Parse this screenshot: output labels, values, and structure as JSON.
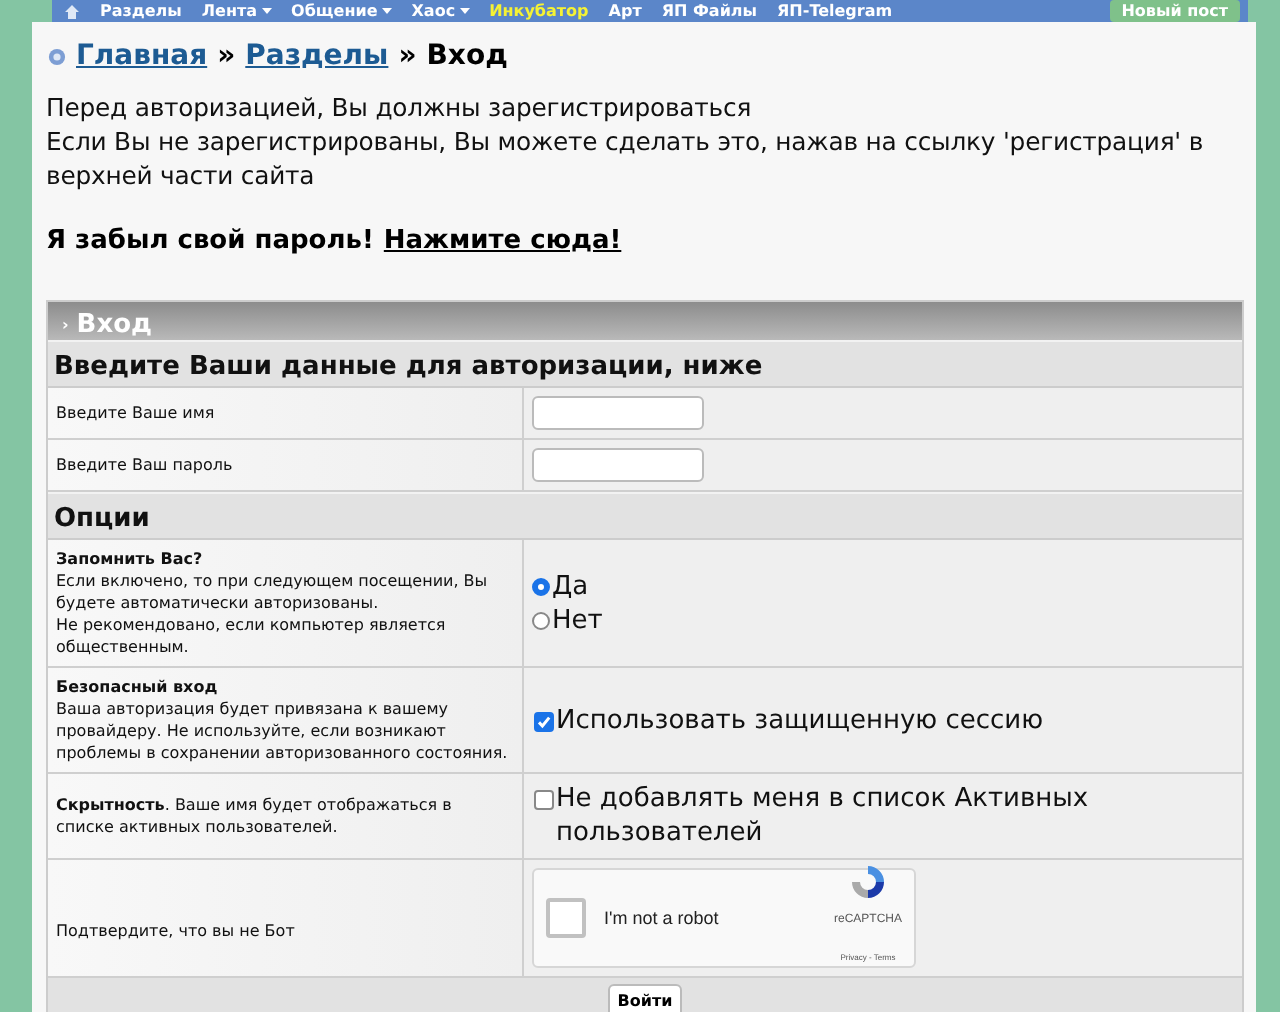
{
  "nav": {
    "items": [
      {
        "label": "Разделы",
        "dropdown": false,
        "highlight": false
      },
      {
        "label": "Лента",
        "dropdown": true,
        "highlight": false
      },
      {
        "label": "Общение",
        "dropdown": true,
        "highlight": false
      },
      {
        "label": "Хаос",
        "dropdown": true,
        "highlight": false
      },
      {
        "label": "Инкубатор",
        "dropdown": false,
        "highlight": true
      },
      {
        "label": "Арт",
        "dropdown": false,
        "highlight": false
      },
      {
        "label": "ЯП Файлы",
        "dropdown": false,
        "highlight": false
      },
      {
        "label": "ЯП-Telegram",
        "dropdown": false,
        "highlight": false
      }
    ],
    "new_post_button": "Новый пост"
  },
  "breadcrumbs": [
    {
      "label": "Главная",
      "link": true
    },
    {
      "label": "Разделы",
      "link": true
    },
    {
      "label": "Вход",
      "link": false
    }
  ],
  "separator": "»",
  "intro": [
    "Перед авторизацией, Вы должны зарегистрироваться",
    "Если Вы не зарегистрированы, Вы можете сделать это, нажав на ссылку 'регистрация' в верхней части сайта"
  ],
  "forgot": {
    "text": "Я забыл свой пароль!",
    "link": "Нажмите сюда!"
  },
  "form": {
    "title": "Вход",
    "marker": "›",
    "credentials": {
      "heading": "Введите Ваши данные для авторизации, ниже",
      "fields": [
        {
          "label": "Введите Ваше имя"
        },
        {
          "label": "Введите Ваш пароль"
        }
      ]
    },
    "options": {
      "heading": "Опции",
      "rows": [
        {
          "kind": "radio",
          "title": "Запомнить Вас?",
          "description": "Если включено, то при следующем посещении, Вы будете автоматически авторизованы.",
          "note": "Не рекомендовано, если компьютер является общественным.",
          "choices": [
            {
              "label": "Да",
              "selected": true
            },
            {
              "label": "Нет",
              "selected": false
            }
          ]
        },
        {
          "kind": "checkbox",
          "title": "Безопасный вход",
          "description": "Ваша авторизация будет привязана к вашему провайдеру. Не используйте, если возникают проблемы в сохранении авторизованного состояния.",
          "label": "Использовать защищенную сессию",
          "checked": true
        },
        {
          "kind": "checkbox",
          "description": "**Скрытность**. Ваше имя будет отображаться в списке активных пользователей.",
          "label": "Не добавлять меня в список Активных пользователей",
          "checked": false
        },
        {
          "kind": "captcha",
          "description": "Подтвердите, что вы не Бот",
          "captcha": {
            "label": "I'm not a robot",
            "checked": false,
            "brand": "reCAPTCHA",
            "links": "Privacy - Terms"
          }
        }
      ]
    },
    "submit": "Войти"
  }
}
